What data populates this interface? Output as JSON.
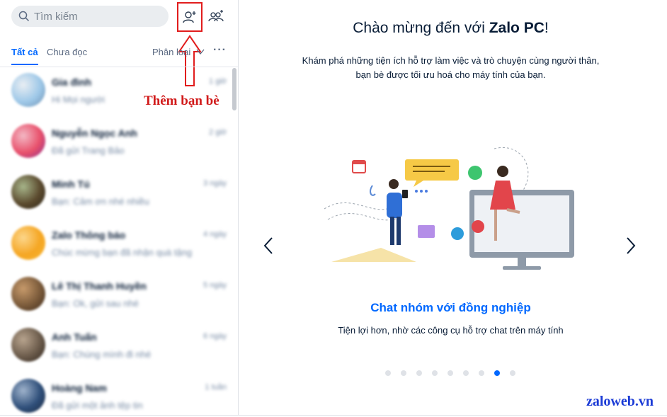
{
  "sidebar": {
    "search": {
      "placeholder": "Tìm kiếm"
    },
    "tabs": {
      "all": "Tất cả",
      "unread": "Chưa đọc",
      "filter": "Phân loại"
    },
    "annotation": "Thêm bạn bè",
    "conversations": [
      {
        "name": "Gia đình",
        "preview": "Hi Mọi người",
        "time": "1 giờ",
        "colors": [
          "#9ec8e8",
          "#e9eef3",
          "#6d8fb0"
        ]
      },
      {
        "name": "Nguyễn Ngọc Anh",
        "preview": "Đã gửi Trang Bảo",
        "time": "2 giờ",
        "colors": [
          "#e8506b",
          "#f3b8c4",
          "#8b2f8f"
        ]
      },
      {
        "name": "Minh Tú",
        "preview": "Bạn: Cảm ơn nhé nhiều",
        "time": "3 ngày",
        "colors": [
          "#5b4a2e",
          "#a7b58a",
          "#2b2418"
        ]
      },
      {
        "name": "Zalo Thông báo",
        "preview": "Chúc mừng bạn đã nhận quà tặng",
        "time": "4 ngày",
        "colors": [
          "#f5a623",
          "#fcd68b",
          "#f7b733"
        ]
      },
      {
        "name": "Lê Thị Thanh Huyền",
        "preview": "Bạn: Ok, gửi sau nhé",
        "time": "5 ngày",
        "colors": [
          "#7a5a3a",
          "#c79a6b",
          "#3d2a1a"
        ]
      },
      {
        "name": "Anh Tuấn",
        "preview": "Bạn: Chúng mình đi nhé",
        "time": "6 ngày",
        "colors": [
          "#6b5b4b",
          "#b8a48e",
          "#2e241c"
        ]
      },
      {
        "name": "Hoàng Nam",
        "preview": "Đã gửi một ảnh tệp tin",
        "time": "1 tuần",
        "colors": [
          "#2f4f7a",
          "#9fb3cc",
          "#1c2a40"
        ]
      }
    ]
  },
  "main": {
    "title_prefix": "Chào mừng đến với ",
    "title_brand": "Zalo PC",
    "title_suffix": "!",
    "description": "Khám phá những tiện ích hỗ trợ làm việc và trò chuyện cùng người thân, bạn bè được tối ưu hoá cho máy tính của bạn.",
    "slide_title": "Chat nhóm với đồng nghiệp",
    "slide_desc": "Tiện lợi hơn, nhờ các công cụ hỗ trợ chat trên máy tính",
    "slides_count": 9,
    "active_slide": 8
  },
  "watermark": "zaloweb.vn",
  "colors": {
    "accent": "#0068ff",
    "annotation": "#d11b1b",
    "watermark": "#1b3bd6"
  }
}
